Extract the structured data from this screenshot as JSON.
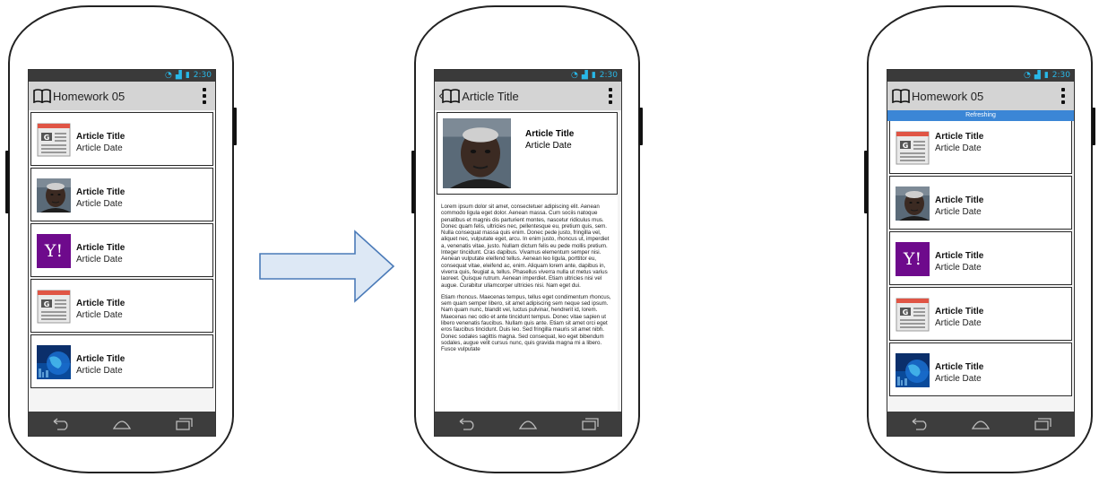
{
  "screens": {
    "list": {
      "app_title": "Homework 05",
      "status_time": "2:30",
      "items": [
        {
          "title": "Article Title",
          "date": "Article Date",
          "thumb": "newspaper-icon"
        },
        {
          "title": "Article Title",
          "date": "Article Date",
          "thumb": "portrait-photo"
        },
        {
          "title": "Article Title",
          "date": "Article Date",
          "thumb": "yahoo-logo"
        },
        {
          "title": "Article Title",
          "date": "Article Date",
          "thumb": "newspaper-icon"
        },
        {
          "title": "Article Title",
          "date": "Article Date",
          "thumb": "globe-image"
        }
      ]
    },
    "detail": {
      "app_title": "Article Title",
      "status_time": "2:30",
      "title": "Article Title",
      "date": "Article Date",
      "body": [
        "Lorem ipsum dolor sit amet, consectetuer adipiscing elit. Aenean commodo ligula eget dolor. Aenean massa. Cum sociis natoque penatibus et magnis dis parturient montes, nascetur ridiculus mus. Donec quam felis, ultricies nec, pellentesque eu, pretium quis, sem. Nulla consequat massa quis enim. Donec pede justo, fringilla vel, aliquet nec, vulputate eget, arcu. In enim justo, rhoncus ut, imperdiet a, venenatis vitae, justo. Nullam dictum felis eu pede mollis pretium. Integer tincidunt. Cras dapibus. Vivamus elementum semper nisi. Aenean vulputate eleifend tellus. Aenean leo ligula, porttitor eu, consequat vitae, eleifend ac, enim. Aliquam lorem ante, dapibus in, viverra quis, feugiat a, tellus. Phasellus viverra nulla ut metus varius laoreet. Quisque rutrum. Aenean imperdiet. Etiam ultricies nisi vel augue. Curabitur ullamcorper ultricies nisi. Nam eget dui.",
        "Etiam rhoncus. Maecenas tempus, tellus eget condimentum rhoncus, sem quam semper libero, sit amet adipiscing sem neque sed ipsum. Nam quam nunc, blandit vel, luctus pulvinar, hendrerit id, lorem. Maecenas nec odio et ante tincidunt tempus. Donec vitae sapien ut libero venenatis faucibus. Nullam quis ante. Etiam sit amet orci eget eros faucibus tincidunt. Duis leo. Sed fringilla mauris sit amet nibh. Donec sodales sagittis magna. Sed consequat, leo eget bibendum sodales, augue velit cursus nunc, quis gravida magna mi a libero. Fusce vulputate"
      ]
    },
    "refreshing": {
      "app_title": "Homework 05",
      "status_time": "2:30",
      "refresh_label": "Refreshing",
      "items": [
        {
          "title": "Article Title",
          "date": "Article Date",
          "thumb": "newspaper-icon"
        },
        {
          "title": "Article Title",
          "date": "Article Date",
          "thumb": "portrait-photo"
        },
        {
          "title": "Article Title",
          "date": "Article Date",
          "thumb": "yahoo-logo"
        },
        {
          "title": "Article Title",
          "date": "Article Date",
          "thumb": "newspaper-icon"
        },
        {
          "title": "Article Title",
          "date": "Article Date",
          "thumb": "globe-image"
        }
      ]
    }
  },
  "yahoo_logo_text": "Y!",
  "colors": {
    "status_accent": "#28b8e8",
    "action_bar": "#d4d4d4",
    "nav_bar": "#3d3d3d",
    "refresh_bar": "#3b86d6",
    "yahoo_purple": "#6e0a8c",
    "arrow_fill": "#dde8f5",
    "arrow_stroke": "#4a7ab8"
  }
}
